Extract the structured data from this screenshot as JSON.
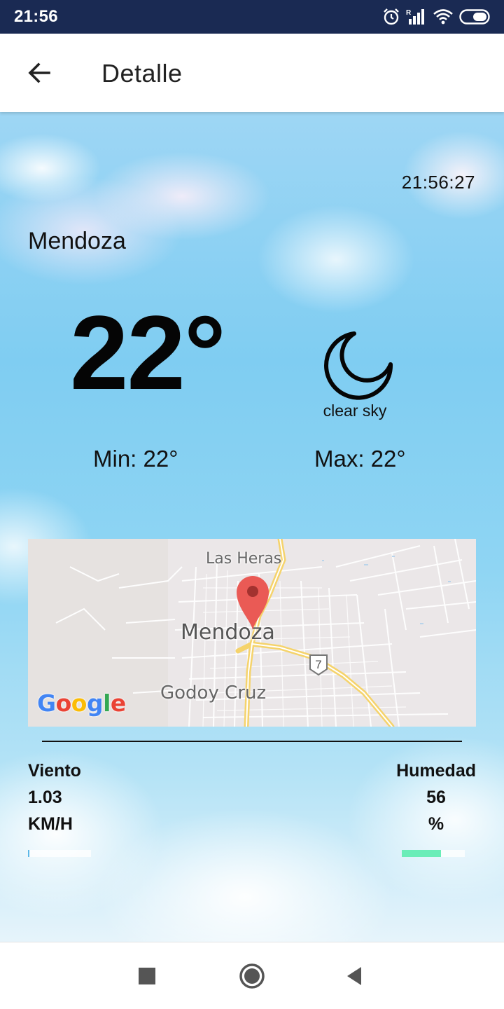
{
  "status_bar": {
    "time": "21:56",
    "icons": [
      "alarm-icon",
      "signal-icon",
      "wifi-icon",
      "battery-icon"
    ]
  },
  "app_bar": {
    "title": "Detalle",
    "back_icon": "arrow-back-icon"
  },
  "weather": {
    "clock": "21:56:27",
    "city": "Mendoza",
    "temperature": "22°",
    "icon": "moon-icon",
    "description": "clear sky",
    "min": "Min: 22°",
    "max": "Max: 22°"
  },
  "map": {
    "labels": {
      "north": "Las Heras",
      "center": "Mendoza",
      "south": "Godoy Cruz"
    },
    "route_number": "7",
    "provider": "Google"
  },
  "stats": {
    "wind": {
      "label": "Viento",
      "value": "1.03",
      "unit": "KM/H",
      "bar_fraction": 0.01,
      "bar_color": "#5cb8e8"
    },
    "humidity": {
      "label": "Humedad",
      "value": "56",
      "unit": "%",
      "bar_fraction": 0.62,
      "bar_color": "#6aedb8"
    }
  },
  "nav_bar": {
    "icons": [
      "recents-square-icon",
      "home-circle-icon",
      "back-triangle-icon"
    ]
  },
  "colors": {
    "status_bar": "#1a2a53",
    "pin": "#ea5a55",
    "road_major": "#f5d36b"
  }
}
